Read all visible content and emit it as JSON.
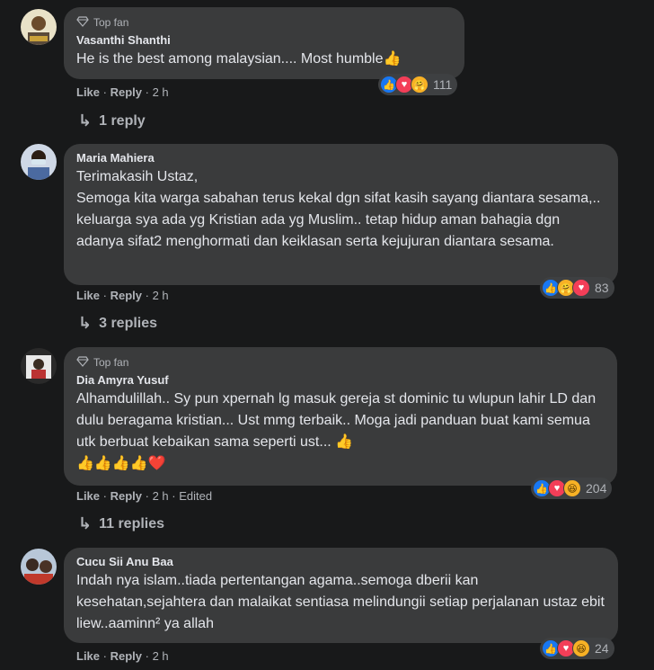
{
  "comments": [
    {
      "badge": "Top fan",
      "author": "Vasanthi Shanthi",
      "text": "He is the best among malaysian.... Most humble👍",
      "like": "Like",
      "reply": "Reply",
      "time": "2 h",
      "reaction_count": "111",
      "replies": "1 reply"
    },
    {
      "author": "Maria Mahiera",
      "text": "Terimakasih Ustaz,\nSemoga kita warga sabahan terus kekal dgn sifat kasih sayang diantara sesama,.. keluarga sya ada yg Kristian ada yg Muslim.. tetap hidup aman bahagia dgn adanya sifat2 menghormati dan keiklasan serta kejujuran diantara sesama.",
      "like": "Like",
      "reply": "Reply",
      "time": "2 h",
      "reaction_count": "83",
      "replies": "3 replies"
    },
    {
      "badge": "Top fan",
      "author": "Dia Amyra Yusuf",
      "text": "Alhamdulillah.. Sy pun xpernah lg masuk gereja st dominic tu wlupun lahir LD dan dulu beragama kristian... Ust mmg terbaik.. Moga jadi panduan buat kami semua utk berbuat kebaikan sama seperti ust... 👍\n👍👍👍👍❤️",
      "like": "Like",
      "reply": "Reply",
      "time": "2 h",
      "edited": "Edited",
      "reaction_count": "204",
      "replies": "11 replies"
    },
    {
      "author": "Cucu Sii Anu Baa",
      "text": "Indah nya islam..tiada pertentangan agama..semoga dberii kan kesehatan,sejahtera dan malaikat sentiasa melindungii setiap perjalanan ustaz ebit liew..aaminn² ya allah",
      "like": "Like",
      "reply": "Reply",
      "time": "2 h",
      "reaction_count": "24"
    }
  ],
  "icons": {
    "badge": "diamond-icon",
    "reply_arrow": "reply-arrow-icon"
  }
}
